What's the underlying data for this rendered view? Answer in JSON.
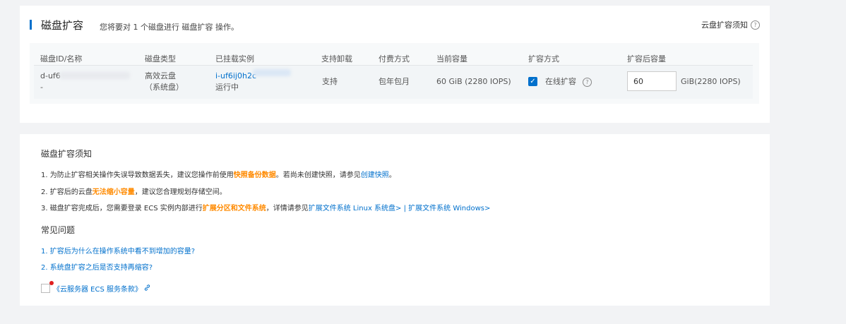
{
  "header": {
    "title": "磁盘扩容",
    "description": "您将要对 1 个磁盘进行 磁盘扩容 操作。",
    "help_link": "云盘扩容须知"
  },
  "table": {
    "columns": [
      "磁盘ID/名称",
      "磁盘类型",
      "已挂载实例",
      "支持卸载",
      "付费方式",
      "当前容量",
      "扩容方式",
      "扩容后容量"
    ],
    "row": {
      "disk_id": "d-uf6",
      "disk_name": "-",
      "disk_type": "高效云盘",
      "disk_category": "（系统盘）",
      "instance_id": "i-uf6ij0h2c",
      "instance_status": "运行中",
      "detachable": "支持",
      "billing": "包年包月",
      "current_capacity": "60 GiB (2280 IOPS)",
      "online_resize_label": "在线扩容",
      "online_resize_checked": true,
      "new_capacity_value": "60",
      "new_capacity_unit": "GiB(2280 IOPS)"
    }
  },
  "notice": {
    "title": "磁盘扩容须知",
    "item1": {
      "prefix": "1. 为防止扩容相关操作失误导致数据丢失，建议您操作前使用",
      "highlight": "快照备份数据",
      "middle": "。若尚未创建快照，请参见",
      "link": "创建快照",
      "suffix": "。"
    },
    "item2": {
      "prefix": "2. 扩容后的云盘",
      "highlight": "无法缩小容量",
      "suffix": "，建议您合理规划存储空间。"
    },
    "item3": {
      "prefix": "3. 磁盘扩容完成后，您需要登录 ECS 实例内部进行",
      "highlight": "扩展分区和文件系统",
      "middle": "，详情请参见",
      "link_linux": "扩展文件系统 Linux 系统盘>",
      "separator": " | ",
      "link_windows": "扩展文件系统 Windows>"
    }
  },
  "faq": {
    "title": "常见问题",
    "q1": "1. 扩容后为什么在操作系统中看不到增加的容量?",
    "q2": "2. 系统盘扩容之后是否支持再缩容?"
  },
  "agreement": {
    "label": "《云服务器 ECS 服务条款》",
    "link_icon": "link-icon"
  }
}
